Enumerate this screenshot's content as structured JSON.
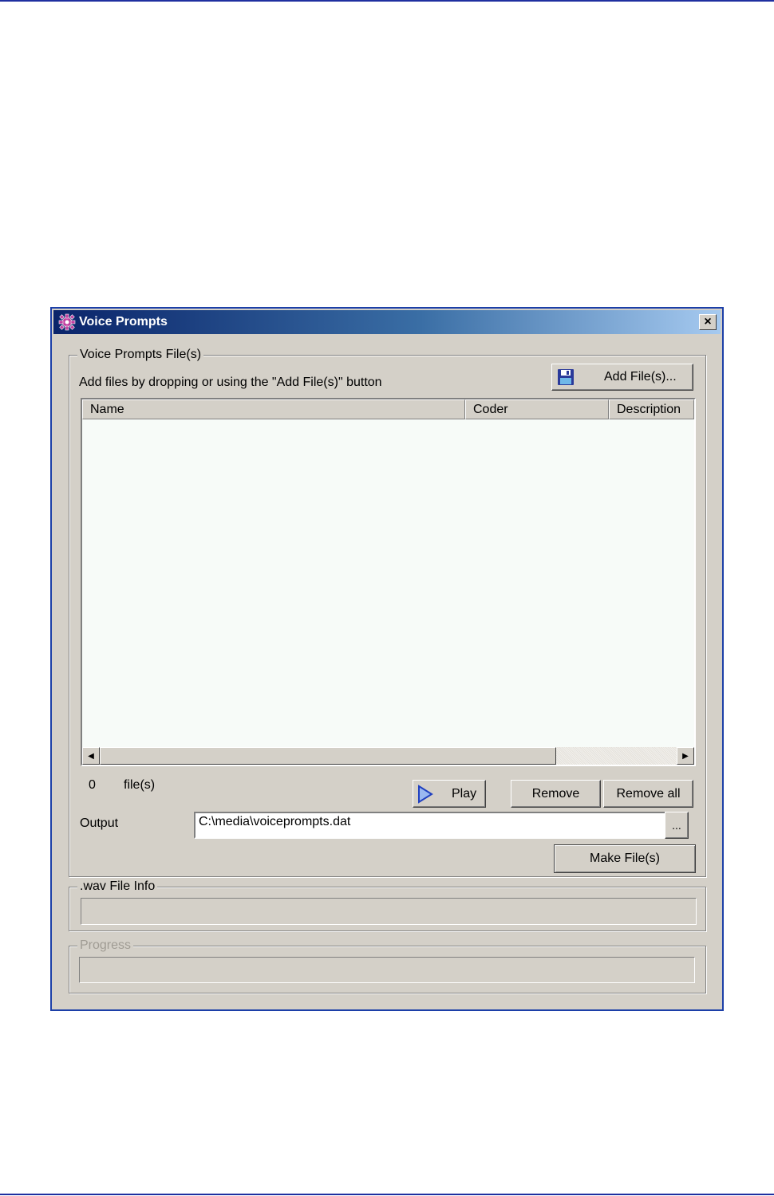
{
  "window": {
    "title": "Voice Prompts",
    "close_label": "×"
  },
  "files_group": {
    "label": "Voice Prompts File(s)",
    "hint": "Add files by dropping or using the \"Add File(s)\" button",
    "add_button": "Add File(s)...",
    "columns": [
      "Name",
      "Coder",
      "Description"
    ],
    "file_count": "0",
    "file_count_label": "file(s)",
    "play_button": "Play",
    "remove_button": "Remove",
    "remove_all_button": "Remove all",
    "output_label": "Output",
    "output_value": "C:\\media\\voiceprompts.dat",
    "browse_button": "...",
    "make_button": "Make File(s)"
  },
  "wav_group": {
    "label": ".wav File Info",
    "value": ""
  },
  "progress_group": {
    "label": "Progress",
    "value": 0
  },
  "icons": {
    "title": "gear-icon",
    "add": "floppy-disk-icon",
    "play": "play-icon"
  },
  "colors": {
    "titlebar_start": "#0a246a",
    "titlebar_end": "#a6caf0",
    "window_face": "#d4d0c8",
    "window_border": "#1c3fa8"
  }
}
